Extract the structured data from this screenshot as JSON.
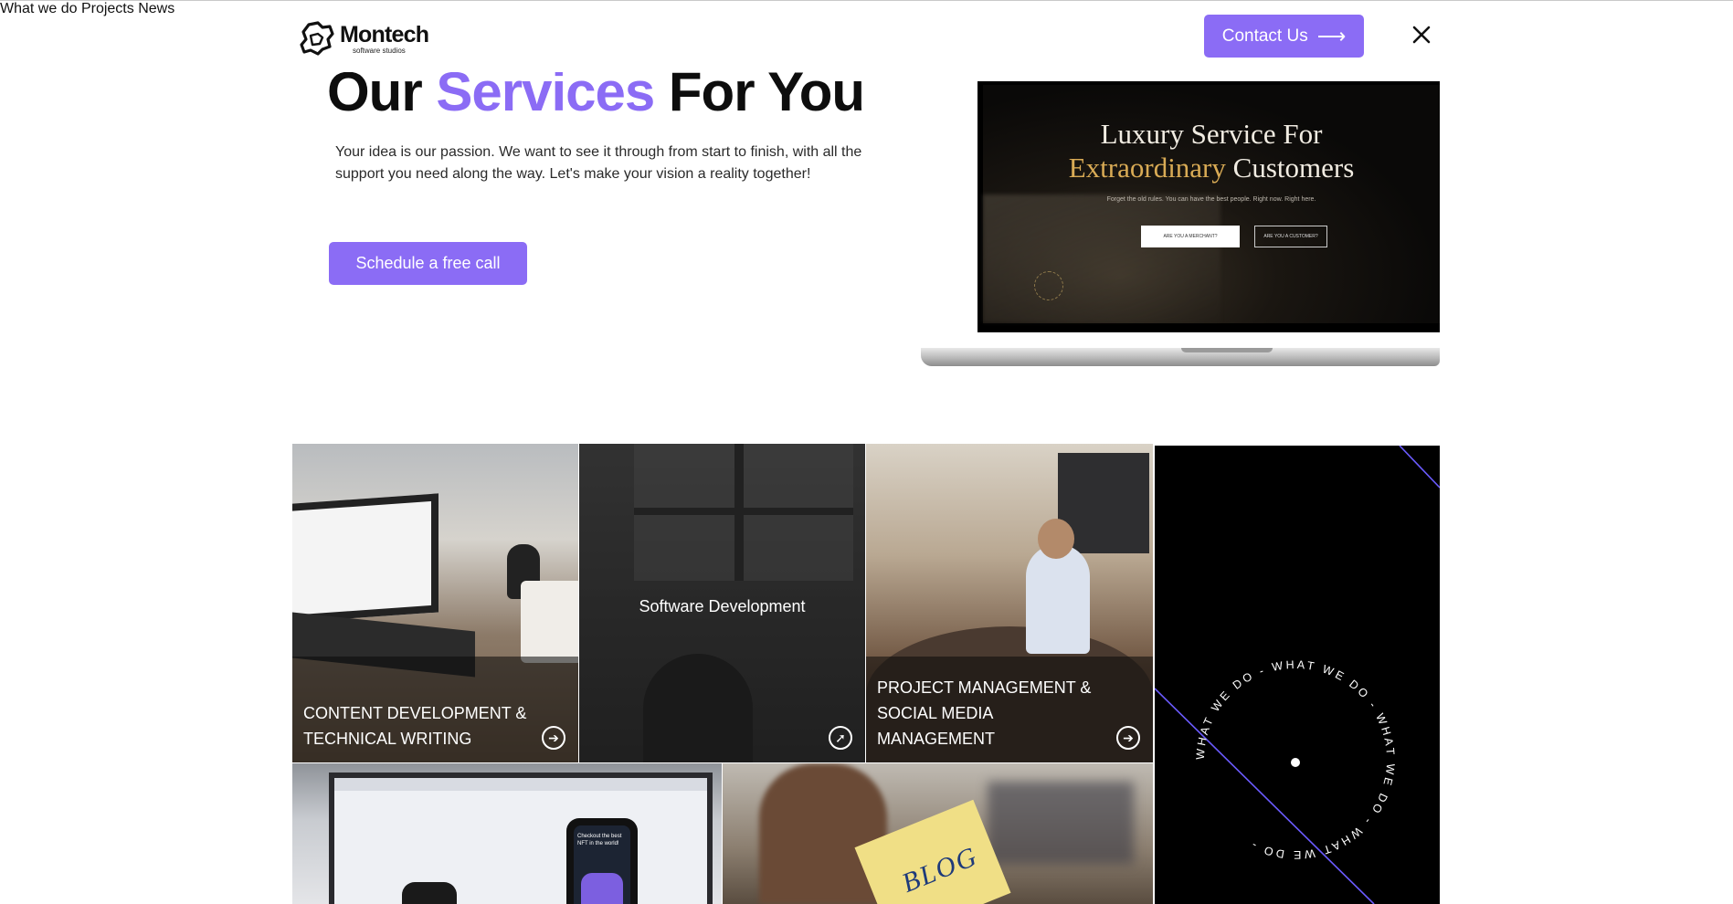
{
  "brand": {
    "name": "Montech",
    "tagline": "software studios"
  },
  "nav": {
    "items": [
      "What we do",
      "Projects",
      "News"
    ],
    "contact_label": "Contact Us"
  },
  "hero": {
    "title_part1": "Our ",
    "title_accent": "Services",
    "title_part2": " For You",
    "description": "Your idea is our passion. We want to see it through from start to finish, with all the support you need along the way. Let's make your vision a reality together!",
    "cta_label": "Schedule a free call"
  },
  "laptop_screen": {
    "line1": "Luxury Service For",
    "line2_gold": "Extraordinary",
    "line2_rest": " Customers",
    "subtitle": "Forget the old rules. You can have the best people. Right now. Right here.",
    "button1": "ARE YOU A MERCHANT?",
    "button2": "ARE YOU A CUSTOMER?"
  },
  "services": [
    {
      "title": "CONTENT DEVELOPMENT & TECHNICAL WRITING"
    },
    {
      "title": "Software Development"
    },
    {
      "title": "PROJECT MANAGEMENT & SOCIAL MEDIA MANAGEMENT"
    }
  ],
  "circle_text": "WHAT WE DO - WHAT WE DO - WHAT WE DO - WHAT WE DO - ",
  "phone_text": "Checkout the best NFT in the world!",
  "note_text": "BLOG",
  "colors": {
    "accent": "#8b6cf5",
    "diag_line": "#6b5bff"
  }
}
